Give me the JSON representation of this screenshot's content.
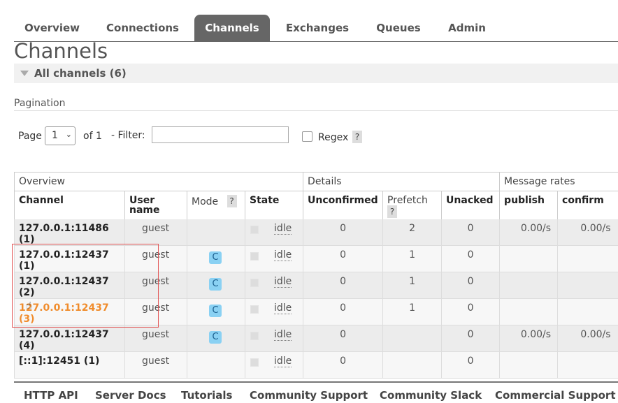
{
  "nav": {
    "tabs": [
      {
        "label": "Overview"
      },
      {
        "label": "Connections"
      },
      {
        "label": "Channels",
        "active": true
      },
      {
        "label": "Exchanges"
      },
      {
        "label": "Queues"
      },
      {
        "label": "Admin"
      }
    ]
  },
  "page": {
    "title": "Channels",
    "section_title": "All channels (6)"
  },
  "pagination": {
    "label": "Pagination",
    "page_label": "Page",
    "page_value": "1",
    "of_label": "of 1",
    "filter_label": "- Filter:",
    "filter_value": "",
    "regex_label": "Regex",
    "regex_checked": false,
    "help": "?"
  },
  "table": {
    "groups": [
      "Overview",
      "Details",
      "Message rates"
    ],
    "headers": {
      "channel": "Channel",
      "username": "User name",
      "mode": "Mode",
      "state": "State",
      "unconfirmed": "Unconfirmed",
      "prefetch": "Prefetch",
      "unacked": "Unacked",
      "publish": "publish",
      "confirm": "confirm"
    },
    "rows": [
      {
        "channel": "127.0.0.1:11486 (1)",
        "user": "guest",
        "mode": "",
        "state": "idle",
        "unconfirmed": "0",
        "prefetch": "2",
        "unacked": "0",
        "publish": "0.00/s",
        "confirm": "0.00/s"
      },
      {
        "channel": "127.0.0.1:12437 (1)",
        "user": "guest",
        "mode": "C",
        "state": "idle",
        "unconfirmed": "0",
        "prefetch": "1",
        "unacked": "0",
        "publish": "",
        "confirm": ""
      },
      {
        "channel": "127.0.0.1:12437 (2)",
        "user": "guest",
        "mode": "C",
        "state": "idle",
        "unconfirmed": "0",
        "prefetch": "1",
        "unacked": "0",
        "publish": "",
        "confirm": ""
      },
      {
        "channel": "127.0.0.1:12437 (3)",
        "user": "guest",
        "mode": "C",
        "state": "idle",
        "unconfirmed": "0",
        "prefetch": "1",
        "unacked": "0",
        "publish": "",
        "confirm": "",
        "hovered": true
      },
      {
        "channel": "127.0.0.1:12437 (4)",
        "user": "guest",
        "mode": "C",
        "state": "idle",
        "unconfirmed": "0",
        "prefetch": "",
        "unacked": "0",
        "publish": "0.00/s",
        "confirm": "0.00/s"
      },
      {
        "channel": "[::1]:12451 (1)",
        "user": "guest",
        "mode": "",
        "state": "idle",
        "unconfirmed": "0",
        "prefetch": "",
        "unacked": "0",
        "publish": "",
        "confirm": ""
      }
    ]
  },
  "footer": {
    "links": [
      "HTTP API",
      "Server Docs",
      "Tutorials",
      "Community Support",
      "Community Slack",
      "Commercial Support"
    ]
  },
  "colors": {
    "active_tab": "#666666",
    "hover_link": "#f08c2c",
    "mode_badge": "#8ad1f3",
    "annotation_box": "#e25555"
  }
}
